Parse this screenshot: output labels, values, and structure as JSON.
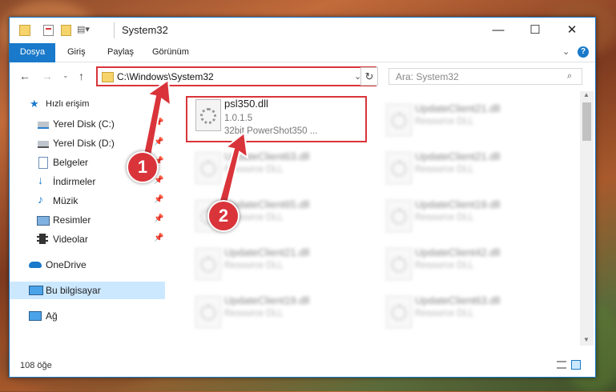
{
  "window": {
    "title": "System32",
    "minimize": "—",
    "maximize": "☐",
    "close": "✕"
  },
  "ribbon": {
    "tabs": [
      "Dosya",
      "Giriş",
      "Paylaş",
      "Görünüm"
    ],
    "help": "?"
  },
  "nav": {
    "back": "←",
    "forward": "→",
    "up": "↑",
    "refresh": "↻",
    "address": "C:\\Windows\\System32",
    "search_placeholder": "Ara: System32"
  },
  "sidebar": {
    "items": [
      {
        "label": "Hızlı erişim",
        "icon": "star-icon",
        "pinned": false
      },
      {
        "label": "Yerel Disk (C:)",
        "icon": "drive-icon",
        "pinned": true
      },
      {
        "label": "Yerel Disk (D:)",
        "icon": "drive-icon",
        "pinned": true
      },
      {
        "label": "Belgeler",
        "icon": "document-icon",
        "pinned": true
      },
      {
        "label": "İndirmeler",
        "icon": "download-icon",
        "pinned": true
      },
      {
        "label": "Müzik",
        "icon": "music-icon",
        "pinned": true
      },
      {
        "label": "Resimler",
        "icon": "pictures-icon",
        "pinned": true
      },
      {
        "label": "Videolar",
        "icon": "video-icon",
        "pinned": true
      },
      {
        "label": "OneDrive",
        "icon": "cloud-icon",
        "pinned": false
      },
      {
        "label": "Bu bilgisayar",
        "icon": "computer-icon",
        "pinned": false
      },
      {
        "label": "Ağ",
        "icon": "network-icon",
        "pinned": false
      }
    ]
  },
  "files": {
    "highlighted": {
      "name": "psl350.dll",
      "version": "1.0.1.5",
      "description": "32bit PowerShot350 ..."
    },
    "blurred": [
      {
        "name": "UpdateClient21.dll",
        "type": "Resource DLL"
      },
      {
        "name": "UpdateClient21.dll",
        "type": "Resource DLL"
      },
      {
        "name": "UpdateClient63.dll",
        "type": "Resource DLL"
      },
      {
        "name": "UpdateClient65.dll",
        "type": "Resource DLL"
      },
      {
        "name": "UpdateClient19.dll",
        "type": "Resource DLL"
      },
      {
        "name": "UpdateClient21.dll",
        "type": "Resource DLL"
      },
      {
        "name": "UpdateClient42.dll",
        "type": "Resource DLL"
      },
      {
        "name": "UpdateClient19.dll",
        "type": "Resource DLL"
      },
      {
        "name": "UpdateClient63.dll",
        "type": "Resource DLL"
      }
    ]
  },
  "annotations": {
    "step1": "1",
    "step2": "2"
  },
  "status": {
    "count": "108 öğe"
  },
  "colors": {
    "accent": "#1979ca",
    "highlight": "#d9343a",
    "selected": "#cce8ff"
  }
}
